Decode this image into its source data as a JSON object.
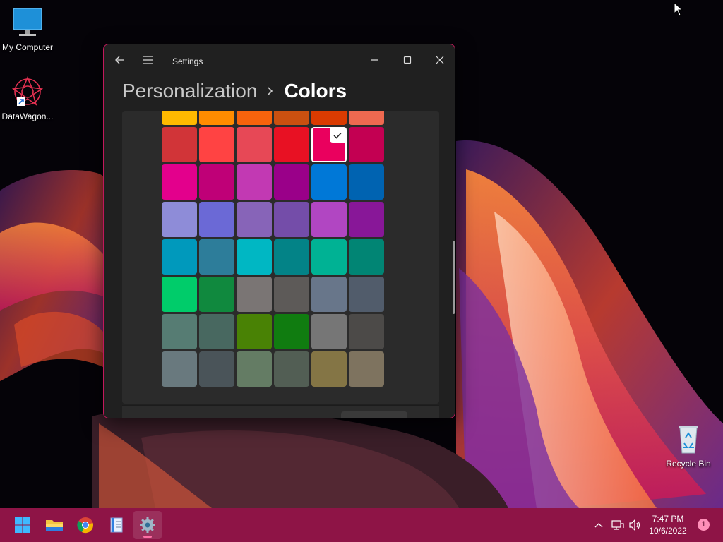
{
  "desktop": {
    "icons": [
      {
        "label": "My Computer",
        "icon": "monitor-icon"
      },
      {
        "label": "DataWagon...",
        "icon": "datawagon-logo-icon"
      },
      {
        "label": "Recycle Bin",
        "icon": "recycle-bin-icon"
      }
    ]
  },
  "window": {
    "app_title": "Settings",
    "breadcrumb": {
      "parent": "Personalization",
      "current": "Colors"
    },
    "buttons": [
      "back-arrow-icon",
      "hamburger-menu-icon",
      "minimize-icon",
      "maximize-icon",
      "close-icon"
    ],
    "accent_colors": [
      "#FFB900",
      "#FF8C00",
      "#F7630C",
      "#CA5010",
      "#DA3B01",
      "#EF6950",
      "#D13438",
      "#FF4343",
      "#E74856",
      "#E81123",
      "#EA005E",
      "#C30052",
      "#E3008C",
      "#BF0077",
      "#C239B3",
      "#9A0089",
      "#0078D7",
      "#0063B1",
      "#8E8CD8",
      "#6B69D6",
      "#8764B8",
      "#744DA9",
      "#B146C2",
      "#881798",
      "#0099BC",
      "#2D7D9A",
      "#00B7C3",
      "#038387",
      "#00B294",
      "#018574",
      "#00CC6A",
      "#10893E",
      "#7A7574",
      "#5D5A58",
      "#68768A",
      "#515C6B",
      "#567C73",
      "#486860",
      "#498205",
      "#107C10",
      "#767676",
      "#4C4A48",
      "#69797E",
      "#4A5459",
      "#647C64",
      "#525E54",
      "#847545",
      "#7E735F"
    ],
    "selected_index": 10
  },
  "taskbar": {
    "apps": [
      "windows-start-icon",
      "file-explorer-icon",
      "chrome-icon",
      "notepad-icon",
      "settings-gear-icon"
    ],
    "active_app": "settings-gear-icon",
    "tray": [
      "chevron-up-icon",
      "network-icon",
      "volume-icon"
    ],
    "time": "7:47 PM",
    "date": "10/6/2022",
    "notification_count": "1",
    "color": "#8E1446"
  }
}
